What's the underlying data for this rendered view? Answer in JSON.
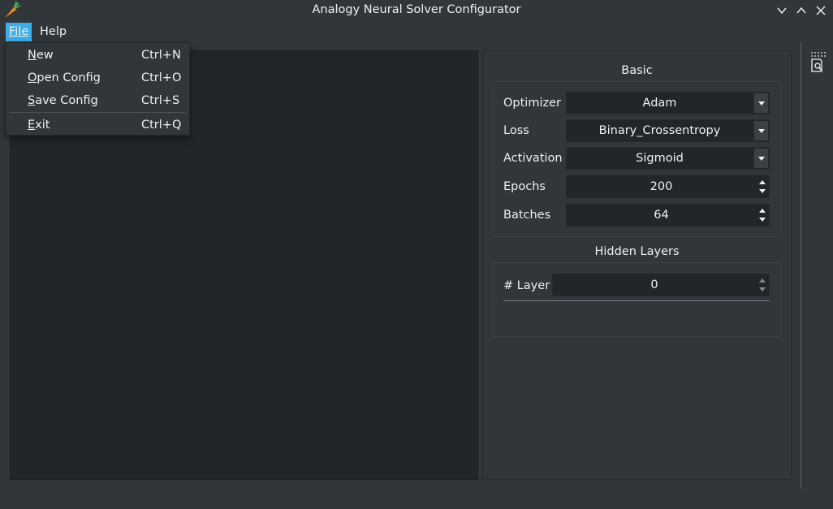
{
  "window": {
    "title": "Analogy Neural Solver Configurator",
    "app_icon": "carrot-icon"
  },
  "menubar": {
    "file": "File",
    "help": "Help"
  },
  "file_menu": {
    "items": [
      {
        "label": "New",
        "mnemonic": "N",
        "rest": "ew",
        "shortcut": "Ctrl+N"
      },
      {
        "label": "Open Config",
        "mnemonic": "O",
        "rest": "pen Config",
        "shortcut": "Ctrl+O"
      },
      {
        "label": "Save Config",
        "mnemonic": "S",
        "rest": "ave Config",
        "shortcut": "Ctrl+S"
      },
      {
        "label": "Exit",
        "mnemonic": "E",
        "rest": "xit",
        "shortcut": "Ctrl+Q"
      }
    ]
  },
  "basic": {
    "title": "Basic",
    "optimizer_label": "Optimizer",
    "optimizer_value": "Adam",
    "loss_label": "Loss",
    "loss_value": "Binary_Crossentropy",
    "activation_label": "Activation",
    "activation_value": "Sigmoid",
    "epochs_label": "Epochs",
    "epochs_value": "200",
    "batches_label": "Batches",
    "batches_value": "64"
  },
  "hidden_layers": {
    "title": "Hidden Layers",
    "layer_label": "# Layer",
    "layer_value": "0"
  },
  "colors": {
    "accent": "#3daee9",
    "window_bg": "#31363b",
    "field_bg": "#232629",
    "text": "#eff0f1"
  }
}
